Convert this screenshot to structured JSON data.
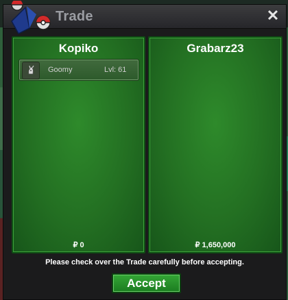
{
  "window": {
    "title": "Trade",
    "close_glyph": "✕"
  },
  "trade": {
    "left": {
      "player_name": "Kopiko",
      "items": [
        {
          "name": "Goomy",
          "level": "Lvl: 61",
          "icon": "pokemon-sprite-icon"
        }
      ],
      "currency_symbol": "₽",
      "money": "0"
    },
    "right": {
      "player_name": "Grabarz23",
      "items": [],
      "currency_symbol": "₽",
      "money": "1,650,000"
    }
  },
  "footer": {
    "notice": "Please check over the Trade carefully before accepting.",
    "accept_label": "Accept"
  },
  "colors": {
    "panel_green": "#236f22",
    "button_green": "#1b7c20",
    "title_gray": "#9b9da3"
  }
}
